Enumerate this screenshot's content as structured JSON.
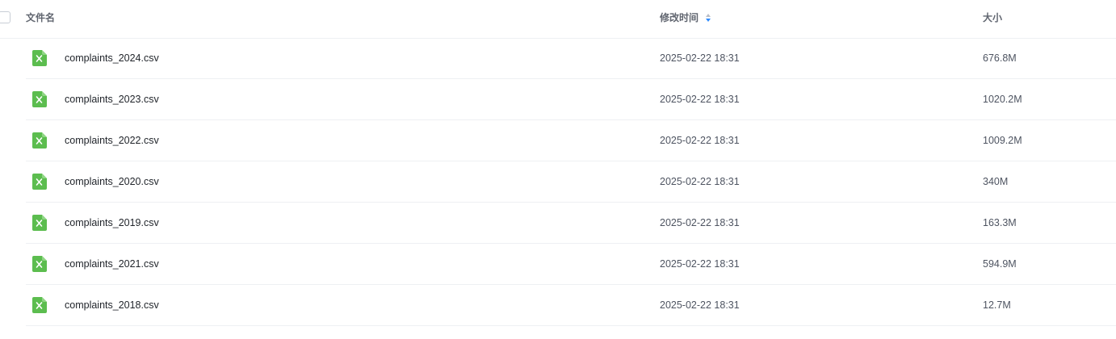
{
  "table": {
    "columns": {
      "name": "文件名",
      "mtime": "修改时间",
      "size": "大小"
    },
    "sort": {
      "column": "mtime",
      "icon": "sort-caret-icon",
      "active_color": "#2e8bff"
    },
    "file_icon": {
      "name": "excel-csv-icon",
      "color": "#5cbd4f"
    },
    "rows": [
      {
        "name": "complaints_2024.csv",
        "mtime": "2025-02-22 18:31",
        "size": "676.8M"
      },
      {
        "name": "complaints_2023.csv",
        "mtime": "2025-02-22 18:31",
        "size": "1020.2M"
      },
      {
        "name": "complaints_2022.csv",
        "mtime": "2025-02-22 18:31",
        "size": "1009.2M"
      },
      {
        "name": "complaints_2020.csv",
        "mtime": "2025-02-22 18:31",
        "size": "340M"
      },
      {
        "name": "complaints_2019.csv",
        "mtime": "2025-02-22 18:31",
        "size": "163.3M"
      },
      {
        "name": "complaints_2021.csv",
        "mtime": "2025-02-22 18:31",
        "size": "594.9M"
      },
      {
        "name": "complaints_2018.csv",
        "mtime": "2025-02-22 18:31",
        "size": "12.7M"
      }
    ]
  }
}
